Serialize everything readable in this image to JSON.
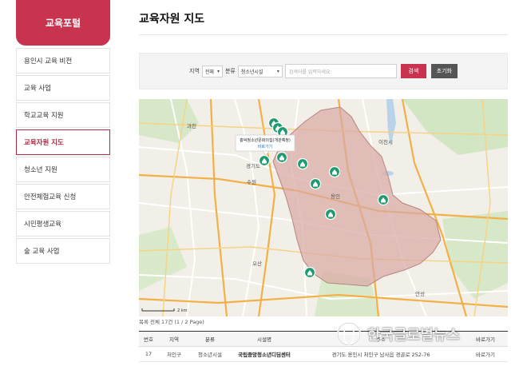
{
  "sidebar": {
    "header": "교육포털",
    "items": [
      {
        "label": "용인시 교육 비전"
      },
      {
        "label": "교육 사업"
      },
      {
        "label": "학교교육 지원"
      },
      {
        "label": "교육자원 지도"
      },
      {
        "label": "청소년 지원"
      },
      {
        "label": "안전체험교육 신청"
      },
      {
        "label": "시민평생교육"
      },
      {
        "label": "숲 교육 사업"
      }
    ],
    "active_index": 3
  },
  "page_title": "교육자원 지도",
  "filter": {
    "region_label": "지역",
    "region_value": "전체",
    "category_label": "분류",
    "category_value": "청소년시설",
    "search_placeholder": "검색어를 입력하세요",
    "search_button": "검색",
    "reset_button": "초기화"
  },
  "map": {
    "popup_title": "흥덕청소년문화의집(개관예정)",
    "popup_link": "바로가기",
    "labels": {
      "gwacheon": "과천",
      "suwon": "수원",
      "yongin": "용인",
      "gyeonggi": "경기도",
      "osan": "오산",
      "icheon": "이천시",
      "anseong": "안성"
    },
    "scale": "2 km",
    "accent": "#1f9b6f",
    "region_fill": "#d9a9a4"
  },
  "results": {
    "summary": "목록 전체 17건 (1 / 2 Page)",
    "headers": [
      "번호",
      "지역",
      "분류",
      "시설명",
      "주소",
      "바로가기"
    ],
    "rows": [
      [
        "17",
        "처인구",
        "청소년시설",
        "국립중앙청소년디딤센터",
        "경기도 용인시 처인구 남사읍 경골로 252-76",
        "바로가기"
      ]
    ]
  },
  "watermark": "한국글로벌뉴스"
}
